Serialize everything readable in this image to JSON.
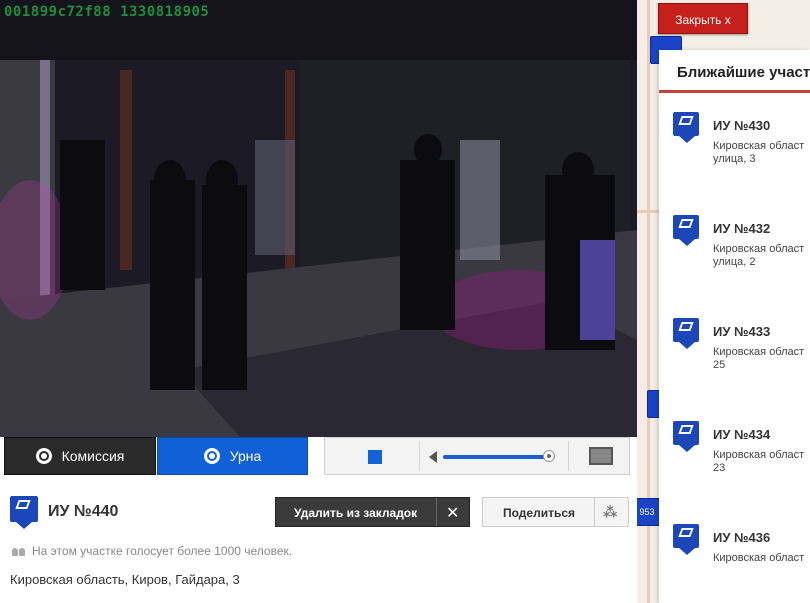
{
  "video": {
    "timestamp": "001899c72f88 1330818905"
  },
  "close_button": {
    "label": "Закрыть  x"
  },
  "tabs": [
    {
      "label": "Комиссия",
      "active": true
    },
    {
      "label": "Урна",
      "active": false
    }
  ],
  "player": {
    "volume": 0.95
  },
  "uik": {
    "title": "ИУ №440",
    "delete_bookmark": "Удалить из закладок",
    "delete_x": "✕",
    "share": "Поделиться",
    "voters": "На этом участке голосует более 1000 человек.",
    "address": "Кировская область, Киров, Гайдара, 3"
  },
  "map": {
    "pin_label": "953"
  },
  "panel": {
    "title": "Ближайшие участки",
    "items": [
      {
        "title": "ИУ №430",
        "address": "Кировская област\nулица, 3"
      },
      {
        "title": "ИУ №432",
        "address": "Кировская област\nулица, 2"
      },
      {
        "title": "ИУ №433",
        "address": "Кировская област\n25"
      },
      {
        "title": "ИУ №434",
        "address": "Кировская област\n23"
      },
      {
        "title": "ИУ №436",
        "address": "Кировская област"
      }
    ]
  },
  "colors": {
    "accent_blue": "#1061d8",
    "close_red": "#c6201c",
    "panel_rule": "#c4413b"
  }
}
